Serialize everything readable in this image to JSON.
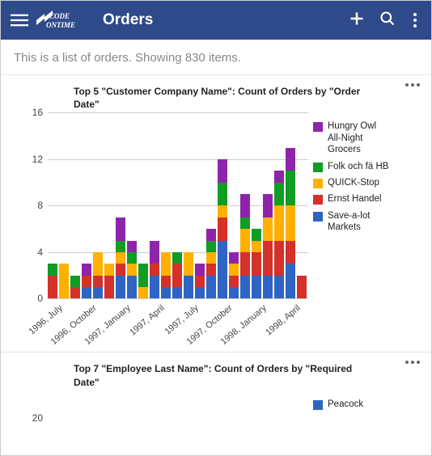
{
  "header": {
    "brand": "CODE ONTIME",
    "title": "Orders"
  },
  "subheader": "This is a list of orders. Showing 830 items.",
  "colors": {
    "purple": "#8e24aa",
    "green": "#0f9d25",
    "orange": "#ffb000",
    "red": "#d3312a",
    "blue": "#2f64c2",
    "appbar": "#2e4a8a"
  },
  "chart_data": [
    {
      "type": "bar",
      "stacked": true,
      "title": "Top 5 \"Customer Company Name\": Count of Orders by \"Order Date\"",
      "ylabel": "",
      "xlabel": "",
      "ylim": [
        0,
        16
      ],
      "yticks": [
        0,
        4,
        8,
        12,
        16
      ],
      "legend_position": "right",
      "series_order": [
        "Save-a-lot Markets",
        "Ernst Handel",
        "QUICK-Stop",
        "Folk och fä HB",
        "Hungry Owl All-Night Grocers"
      ],
      "legend_display_order": [
        "Hungry Owl All-Night Grocers",
        "Folk och fä HB",
        "QUICK-Stop",
        "Ernst Handel",
        "Save-a-lot Markets"
      ],
      "series_colors": {
        "Hungry Owl All-Night Grocers": "purple",
        "Folk och fä HB": "green",
        "QUICK-Stop": "orange",
        "Ernst Handel": "red",
        "Save-a-lot Markets": "blue"
      },
      "categories": [
        "1996, July",
        "",
        "",
        "1996, October",
        "",
        "",
        "1997, January",
        "",
        "",
        "1997, April",
        "",
        "",
        "1997, July",
        "",
        "",
        "1997, October",
        "",
        "",
        "1998, January",
        "",
        "",
        "1998, April",
        ""
      ],
      "data": [
        {
          "Save-a-lot Markets": 0,
          "Ernst Handel": 2,
          "QUICK-Stop": 0,
          "Folk och fä HB": 1,
          "Hungry Owl All-Night Grocers": 0
        },
        {
          "Save-a-lot Markets": 0,
          "Ernst Handel": 0,
          "QUICK-Stop": 3,
          "Folk och fä HB": 0,
          "Hungry Owl All-Night Grocers": 0
        },
        {
          "Save-a-lot Markets": 0,
          "Ernst Handel": 1,
          "QUICK-Stop": 0,
          "Folk och fä HB": 1,
          "Hungry Owl All-Night Grocers": 0
        },
        {
          "Save-a-lot Markets": 1,
          "Ernst Handel": 1,
          "QUICK-Stop": 0,
          "Folk och fä HB": 0,
          "Hungry Owl All-Night Grocers": 1
        },
        {
          "Save-a-lot Markets": 1,
          "Ernst Handel": 1,
          "QUICK-Stop": 2,
          "Folk och fä HB": 0,
          "Hungry Owl All-Night Grocers": 0
        },
        {
          "Save-a-lot Markets": 0,
          "Ernst Handel": 2,
          "QUICK-Stop": 1,
          "Folk och fä HB": 0,
          "Hungry Owl All-Night Grocers": 0
        },
        {
          "Save-a-lot Markets": 2,
          "Ernst Handel": 1,
          "QUICK-Stop": 1,
          "Folk och fä HB": 1,
          "Hungry Owl All-Night Grocers": 2
        },
        {
          "Save-a-lot Markets": 2,
          "Ernst Handel": 0,
          "QUICK-Stop": 1,
          "Folk och fä HB": 1,
          "Hungry Owl All-Night Grocers": 1
        },
        {
          "Save-a-lot Markets": 0,
          "Ernst Handel": 0,
          "QUICK-Stop": 1,
          "Folk och fä HB": 2,
          "Hungry Owl All-Night Grocers": 0
        },
        {
          "Save-a-lot Markets": 2,
          "Ernst Handel": 1,
          "QUICK-Stop": 0,
          "Folk och fä HB": 0,
          "Hungry Owl All-Night Grocers": 2
        },
        {
          "Save-a-lot Markets": 1,
          "Ernst Handel": 1,
          "QUICK-Stop": 2,
          "Folk och fä HB": 0,
          "Hungry Owl All-Night Grocers": 0
        },
        {
          "Save-a-lot Markets": 1,
          "Ernst Handel": 2,
          "QUICK-Stop": 0,
          "Folk och fä HB": 1,
          "Hungry Owl All-Night Grocers": 0
        },
        {
          "Save-a-lot Markets": 2,
          "Ernst Handel": 0,
          "QUICK-Stop": 2,
          "Folk och fä HB": 0,
          "Hungry Owl All-Night Grocers": 0
        },
        {
          "Save-a-lot Markets": 1,
          "Ernst Handel": 1,
          "QUICK-Stop": 0,
          "Folk och fä HB": 0,
          "Hungry Owl All-Night Grocers": 1
        },
        {
          "Save-a-lot Markets": 2,
          "Ernst Handel": 1,
          "QUICK-Stop": 1,
          "Folk och fä HB": 1,
          "Hungry Owl All-Night Grocers": 1
        },
        {
          "Save-a-lot Markets": 5,
          "Ernst Handel": 2,
          "QUICK-Stop": 1,
          "Folk och fä HB": 2,
          "Hungry Owl All-Night Grocers": 2
        },
        {
          "Save-a-lot Markets": 1,
          "Ernst Handel": 1,
          "QUICK-Stop": 1,
          "Folk och fä HB": 0,
          "Hungry Owl All-Night Grocers": 1
        },
        {
          "Save-a-lot Markets": 2,
          "Ernst Handel": 2,
          "QUICK-Stop": 2,
          "Folk och fä HB": 1,
          "Hungry Owl All-Night Grocers": 2
        },
        {
          "Save-a-lot Markets": 2,
          "Ernst Handel": 2,
          "QUICK-Stop": 1,
          "Folk och fä HB": 1,
          "Hungry Owl All-Night Grocers": 0
        },
        {
          "Save-a-lot Markets": 2,
          "Ernst Handel": 3,
          "QUICK-Stop": 2,
          "Folk och fä HB": 0,
          "Hungry Owl All-Night Grocers": 2
        },
        {
          "Save-a-lot Markets": 2,
          "Ernst Handel": 3,
          "QUICK-Stop": 3,
          "Folk och fä HB": 2,
          "Hungry Owl All-Night Grocers": 1
        },
        {
          "Save-a-lot Markets": 3,
          "Ernst Handel": 2,
          "QUICK-Stop": 3,
          "Folk och fä HB": 3,
          "Hungry Owl All-Night Grocers": 2
        },
        {
          "Save-a-lot Markets": 0,
          "Ernst Handel": 2,
          "QUICK-Stop": 0,
          "Folk och fä HB": 0,
          "Hungry Owl All-Night Grocers": 0
        }
      ]
    },
    {
      "type": "bar",
      "stacked": true,
      "title": "Top 7 \"Employee Last Name\": Count of Orders by \"Required Date\"",
      "ylim": [
        0,
        20
      ],
      "yticks": [
        20
      ],
      "legend_position": "right",
      "series_colors": {
        "Peacock": "blue"
      },
      "legend_display_order": [
        "Peacock"
      ],
      "categories": [],
      "data": []
    }
  ]
}
